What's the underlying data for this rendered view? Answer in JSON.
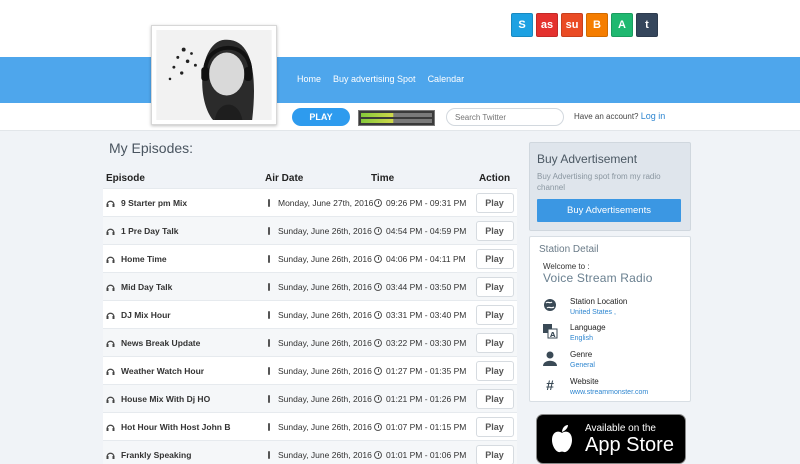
{
  "social": [
    {
      "icon": "skype-icon",
      "glyph": "S",
      "color": "#1da1e2"
    },
    {
      "icon": "lastfm-icon",
      "glyph": "as",
      "color": "#e4312e"
    },
    {
      "icon": "stumbleupon-icon",
      "glyph": "su",
      "color": "#ea4b24"
    },
    {
      "icon": "blogger-icon",
      "glyph": "B",
      "color": "#f57d00"
    },
    {
      "icon": "vine-icon",
      "glyph": "A",
      "color": "#1fb870"
    },
    {
      "icon": "tumblr-icon",
      "glyph": "t",
      "color": "#35465c"
    }
  ],
  "nav": [
    "Home",
    "Buy advertising Spot",
    "Calendar"
  ],
  "toolbar": {
    "play_label": "PLAY",
    "search_placeholder": "Search Twitter",
    "account_text": "Have an account?",
    "login_label": "Log in"
  },
  "episodes": {
    "title": "My Episodes:",
    "headers": {
      "episode": "Episode",
      "air_date": "Air Date",
      "time": "Time",
      "action": "Action"
    },
    "rows": [
      {
        "name": "9 Starter pm Mix",
        "date": "Monday, June 27th, 2016",
        "time": "09:26 PM - 09:31 PM",
        "action": "Play"
      },
      {
        "name": "1 Pre Day Talk",
        "date": "Sunday, June 26th, 2016",
        "time": "04:54 PM - 04:59 PM",
        "action": "Play"
      },
      {
        "name": "Home Time",
        "date": "Sunday, June 26th, 2016",
        "time": "04:06 PM - 04:11 PM",
        "action": "Play"
      },
      {
        "name": "Mid Day Talk",
        "date": "Sunday, June 26th, 2016",
        "time": "03:44 PM - 03:50 PM",
        "action": "Play"
      },
      {
        "name": "DJ Mix Hour",
        "date": "Sunday, June 26th, 2016",
        "time": "03:31 PM - 03:40 PM",
        "action": "Play"
      },
      {
        "name": "News Break Update",
        "date": "Sunday, June 26th, 2016",
        "time": "03:22 PM - 03:30 PM",
        "action": "Play"
      },
      {
        "name": "Weather Watch Hour",
        "date": "Sunday, June 26th, 2016",
        "time": "01:27 PM - 01:35 PM",
        "action": "Play"
      },
      {
        "name": "House Mix With Dj HO",
        "date": "Sunday, June 26th, 2016",
        "time": "01:21 PM - 01:26 PM",
        "action": "Play"
      },
      {
        "name": "Hot Hour With Host John B",
        "date": "Sunday, June 26th, 2016",
        "time": "01:07 PM - 01:15 PM",
        "action": "Play"
      },
      {
        "name": "Frankly Speaking",
        "date": "Sunday, June 26th, 2016",
        "time": "01:01 PM - 01:06 PM",
        "action": "Play"
      }
    ]
  },
  "ad": {
    "title": "Buy Advertisement",
    "desc": "Buy Advertising spot from my radio channel",
    "button": "Buy Advertisements"
  },
  "station": {
    "heading": "Station Detail",
    "welcome": "Welcome to :",
    "name": "Voice Stream Radio",
    "items": [
      {
        "icon": "globe-icon",
        "label": "Station Location",
        "value": "United States ,"
      },
      {
        "icon": "language-icon",
        "label": "Language",
        "value": "English"
      },
      {
        "icon": "user-icon",
        "label": "Genre",
        "value": "General"
      },
      {
        "icon": "hashtag-icon",
        "label": "Website",
        "value": "www.streammonster.com"
      }
    ]
  },
  "appstore": {
    "small": "Available on the",
    "big": "App Store"
  }
}
